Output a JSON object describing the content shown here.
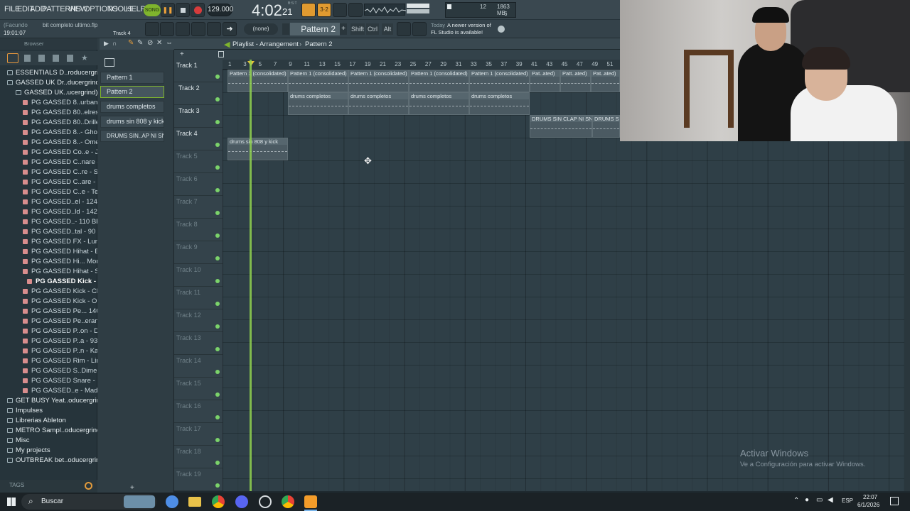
{
  "menu": [
    "FILE",
    "EDIT",
    "ADD",
    "PATTERNS",
    "VIEW",
    "OPTIONS",
    "TOOLS",
    "HELP"
  ],
  "transport": {
    "mode": "SONG",
    "tempo": "129.000",
    "time": "4:02",
    "time_sub": "21",
    "time_label": "B:S:T"
  },
  "monitor": {
    "cpu": "12",
    "ram": "1863 MB",
    "poly": "6"
  },
  "hint": {
    "user": "(Facundo",
    "project": "bit completo ultimo.flp",
    "elapsed": "19:01:07",
    "track": "Track 4"
  },
  "toolbar": {
    "snap": "(none)",
    "pattern": "Pattern 2",
    "shift": "Shift",
    "ctrl": "Ctrl",
    "alt": "Alt",
    "news_today": "Today",
    "news_line1": "A newer version of",
    "news_line2": "FL Studio is available!"
  },
  "browser": {
    "title": "Browser",
    "items": [
      {
        "label": "ESSENTIALS D..roducergrind)",
        "type": "folder"
      },
      {
        "label": "GASSED UK Dr..ducergrind)",
        "type": "folder"
      },
      {
        "label": "GASSED UK..ucergrind)",
        "type": "folder"
      },
      {
        "label": "PG GASSED 8..urbank - C",
        "type": "file"
      },
      {
        "label": "PG GASSED 80..elresto - C",
        "type": "file"
      },
      {
        "label": "PG GASSED 80..Driller - C",
        "type": "file"
      },
      {
        "label": "PG GASSED 8..- Ghost - C",
        "type": "file"
      },
      {
        "label": "PG GASSED 8..- Omen - C",
        "type": "file"
      },
      {
        "label": "PG GASSED Co..e - Jericho",
        "type": "file"
      },
      {
        "label": "PG GASSED C..nare - Nova",
        "type": "file"
      },
      {
        "label": "PG GASSED C..re - Stormz",
        "type": "file"
      },
      {
        "label": "PG GASSED C..are - Talon",
        "type": "file"
      },
      {
        "label": "PG GASSED C..e - Tempest",
        "type": "file"
      },
      {
        "label": "PG GASSED..el - 124 BPM",
        "type": "file"
      },
      {
        "label": "PG GASSED..ld - 142 BPM",
        "type": "file"
      },
      {
        "label": "PG GASSED..- 110 BPM C",
        "type": "file"
      },
      {
        "label": "PG GASSED..tal - 90 BPM",
        "type": "file"
      },
      {
        "label": "PG GASSED FX - Lunar - C",
        "type": "file"
      },
      {
        "label": "PG GASSED Hihat - Blazed",
        "type": "file"
      },
      {
        "label": "PG GASSED Hi... Monolith",
        "type": "file"
      },
      {
        "label": "PG GASSED Hihat - Shrill",
        "type": "file"
      },
      {
        "label": "PG GASSED Kick - Axel",
        "type": "selected"
      },
      {
        "label": "PG GASSED Kick - Chemist",
        "type": "file"
      },
      {
        "label": "PG GASSED Kick - Onyx",
        "type": "file"
      },
      {
        "label": "PG GASSED Pe... 140 BPM",
        "type": "file"
      },
      {
        "label": "PG GASSED Pe..erang - G",
        "type": "file"
      },
      {
        "label": "PG GASSED P..on - Django",
        "type": "file"
      },
      {
        "label": "PG GASSED P..a - 93 BPM",
        "type": "file"
      },
      {
        "label": "PG GASSED P..n - Kato - G",
        "type": "file"
      },
      {
        "label": "PG GASSED Rim - Limbo",
        "type": "file"
      },
      {
        "label": "PG GASSED S..Dimension",
        "type": "file"
      },
      {
        "label": "PG GASSED Snare - Faded",
        "type": "file"
      },
      {
        "label": "PG GASSED..e - Mad Max",
        "type": "file"
      },
      {
        "label": "GET BUSY Yeat..oducergrind)",
        "type": "folder"
      },
      {
        "label": "Impulses",
        "type": "folder"
      },
      {
        "label": "Librerias Ableton",
        "type": "folder"
      },
      {
        "label": "METRO Sampl..oducergrind)",
        "type": "folder"
      },
      {
        "label": "Misc",
        "type": "folder"
      },
      {
        "label": "My projects",
        "type": "folder"
      },
      {
        "label": "OUTBREAK bet..oducergrind)",
        "type": "folder"
      }
    ],
    "tags": "TAGS"
  },
  "patterns": [
    "Pattern 1",
    "Pattern 2",
    "drums completos",
    "drums sin 808 y kick",
    "DRUMS SIN..AP NI SNARE"
  ],
  "playlist": {
    "title": "Playlist - Arrangement",
    "crumb": "Pattern 2"
  },
  "ruler": [
    "1",
    "3",
    "5",
    "7",
    "9",
    "11",
    "13",
    "15",
    "17",
    "19",
    "21",
    "23",
    "25",
    "27",
    "29",
    "31",
    "33",
    "35",
    "37",
    "39",
    "41",
    "43",
    "45",
    "47",
    "49",
    "51"
  ],
  "tracks": [
    "Track 1",
    "Track 2",
    "Track 3",
    "Track 4",
    "Track 5",
    "Track 6",
    "Track 7",
    "Track 8",
    "Track 9",
    "Track 10",
    "Track 11",
    "Track 12",
    "Track 13",
    "Track 14",
    "Track 15",
    "Track 16",
    "Track 17",
    "Track 18",
    "Track 19"
  ],
  "clips": {
    "t1": [
      "Pattern 1 (consolidated)",
      "Pattern 1 (consolidated)",
      "Pattern 1 (consolidated)",
      "Pattern 1 (consolidated)",
      "Pattern 1 (consolidated)",
      "Pat..ated)",
      "Patt..ated)",
      "Pat..ated)"
    ],
    "t2": [
      "drums completos",
      "drums completos",
      "drums completos",
      "drums completos"
    ],
    "t3": [
      "DRUMS SIN CLAP NI SNARE",
      "DRUMS SIN"
    ],
    "t4": [
      "drums sin 808 y kick"
    ]
  },
  "watermark": {
    "line1": "Activar Windows",
    "line2": "Ve a Configuración para activar Windows."
  },
  "taskbar": {
    "search": "Buscar",
    "lang": "ESP",
    "time": "22:07",
    "date": "6/1/2026"
  }
}
